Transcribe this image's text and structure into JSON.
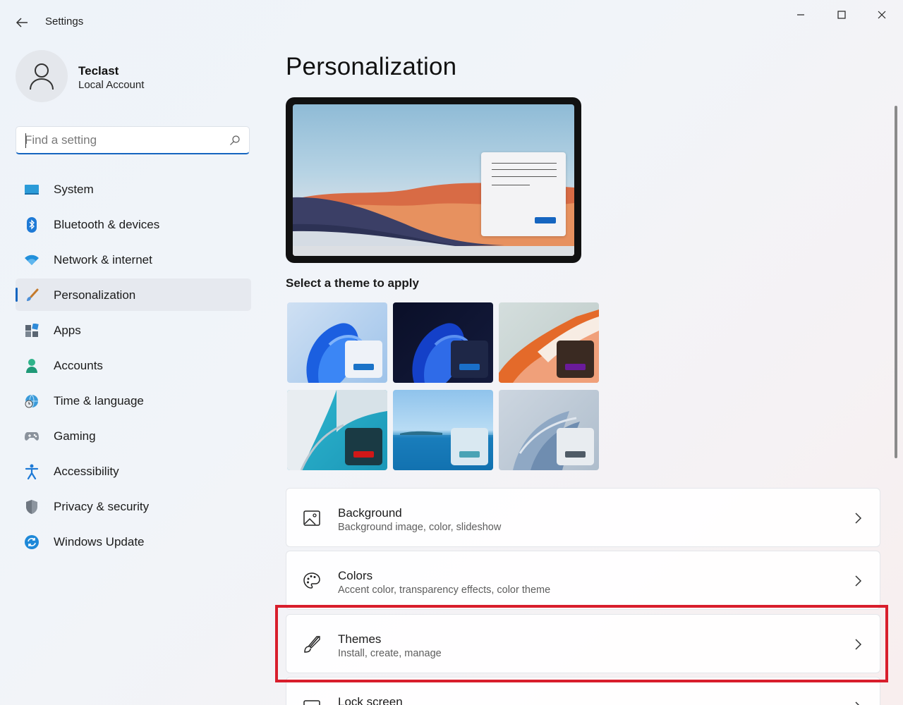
{
  "window": {
    "title": "Settings"
  },
  "profile": {
    "name": "Teclast",
    "account_type": "Local Account"
  },
  "search": {
    "placeholder": "Find a setting",
    "value": ""
  },
  "sidebar": {
    "items": [
      {
        "label": "System",
        "icon": "system-icon"
      },
      {
        "label": "Bluetooth & devices",
        "icon": "bluetooth-icon"
      },
      {
        "label": "Network & internet",
        "icon": "wifi-icon"
      },
      {
        "label": "Personalization",
        "icon": "brush-icon",
        "active": true
      },
      {
        "label": "Apps",
        "icon": "apps-icon"
      },
      {
        "label": "Accounts",
        "icon": "accounts-icon"
      },
      {
        "label": "Time & language",
        "icon": "globe-clock-icon"
      },
      {
        "label": "Gaming",
        "icon": "gamepad-icon"
      },
      {
        "label": "Accessibility",
        "icon": "accessibility-icon"
      },
      {
        "label": "Privacy & security",
        "icon": "shield-icon"
      },
      {
        "label": "Windows Update",
        "icon": "update-icon"
      }
    ]
  },
  "main": {
    "title": "Personalization",
    "theme_section_label": "Select a theme to apply",
    "themes": [
      {
        "name": "windows-light",
        "accent": "#1a73c8"
      },
      {
        "name": "windows-dark",
        "accent": "#1a6fc9"
      },
      {
        "name": "glow",
        "accent": "#6a1b9a"
      },
      {
        "name": "captured-motion",
        "accent": "#d01818"
      },
      {
        "name": "sunrise",
        "accent": "#4aa3b5"
      },
      {
        "name": "flow",
        "accent": "#4f5b66"
      }
    ],
    "cards": [
      {
        "title": "Background",
        "subtitle": "Background image, color, slideshow",
        "icon": "image-icon"
      },
      {
        "title": "Colors",
        "subtitle": "Accent color, transparency effects, color theme",
        "icon": "palette-icon"
      },
      {
        "title": "Themes",
        "subtitle": "Install, create, manage",
        "icon": "paintbrush-icon"
      },
      {
        "title": "Lock screen",
        "subtitle": "",
        "icon": "lock-screen-icon"
      }
    ]
  },
  "colors": {
    "accent": "#1565c0",
    "highlight": "#d81e2c"
  }
}
